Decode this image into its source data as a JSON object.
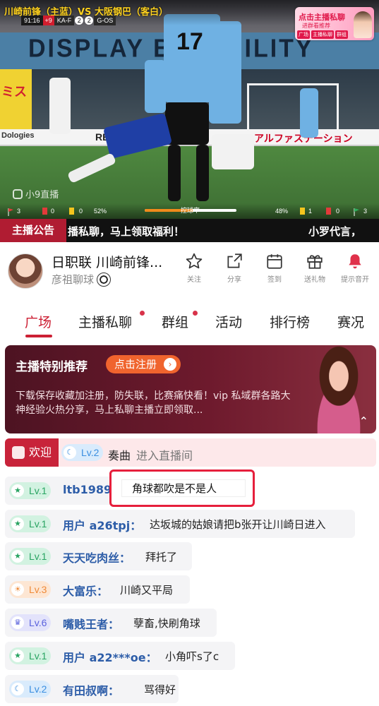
{
  "video": {
    "match_title": "川崎前锋（主蓝）VS 大阪钢巴（客白）",
    "clock": "91:16",
    "indicator": "+9",
    "home_abbr": "KA-F",
    "home_score": "2",
    "away_score": "2",
    "away_abbr": "G-OS",
    "stadium_banner": "DISPLAY B    L ABILITY",
    "ad_left": "Dologies",
    "ad_renault": "RENAULT",
    "ad_jp": "アルファステーション",
    "ad_yellow": "ミス",
    "watermark": "小9直播",
    "promo": {
      "title": "点击主播私聊",
      "subtitle": "进群看推荐",
      "chips": [
        "广场",
        "主播私聊",
        "群组"
      ]
    },
    "stats": {
      "home_corners": "3",
      "home_red": "0",
      "home_yellow": "0",
      "home_possession": "52%",
      "possession_label": "控球率",
      "possession_fraction": 0.52,
      "away_possession": "48%",
      "away_yellow": "1",
      "away_red": "0",
      "away_corners": "3"
    }
  },
  "notice": {
    "tag": "主播公告",
    "scroll_text": "播私聊，马上领取福利！",
    "scroll_text_2": "小罗代言，"
  },
  "streamer": {
    "title": "日职联 川崎前锋...",
    "host": "彦祖聊球",
    "actions": [
      {
        "icon": "star-icon",
        "label": "关注"
      },
      {
        "icon": "share-icon",
        "label": "分享"
      },
      {
        "icon": "calendar-icon",
        "label": "签到"
      },
      {
        "icon": "gift-icon",
        "label": "送礼物"
      },
      {
        "icon": "bell-icon",
        "label": "提示音开"
      }
    ]
  },
  "tabs": [
    "广场",
    "主播私聊",
    "群组",
    "活动",
    "排行榜",
    "赛况"
  ],
  "recommend": {
    "title": "主播特别推荐",
    "button": "点击注册",
    "desc": "下载保存收藏加注册，防失联，比赛痛快看！vip 私域群各路大神经验火热分享，马上私聊主播立即领取..."
  },
  "welcome": {
    "tag": "欢迎",
    "level": "Lv.2",
    "user": "奏曲",
    "action": "进入直播间"
  },
  "messages": [
    {
      "level": "Lv.1",
      "user": "ltb1989",
      "text": ""
    },
    {
      "level": "Lv.1",
      "user": "用户 a26tpj：",
      "text": "达坂城的姑娘请把b张开让川崎日进入"
    },
    {
      "level": "Lv.1",
      "user": "天天吃肉丝：",
      "text": "拜托了"
    },
    {
      "level": "Lv.3",
      "user": "大富乐：",
      "text": "川崎又平局"
    },
    {
      "level": "Lv.6",
      "user": "嘴贱王者：",
      "text": "孽畜,快刷角球"
    },
    {
      "level": "Lv.1",
      "user": "用户 a22***oe：",
      "text": "小角吓s了c"
    },
    {
      "level": "Lv.2",
      "user": "有田叔啊：",
      "text": "骂得好"
    }
  ],
  "popup": {
    "text": "角球都吹是不是人"
  },
  "colors": {
    "accent": "#cc2034",
    "notice_tag": "#b01c32",
    "register_button": "#f0642e",
    "popup_border": "#e61f3c"
  }
}
